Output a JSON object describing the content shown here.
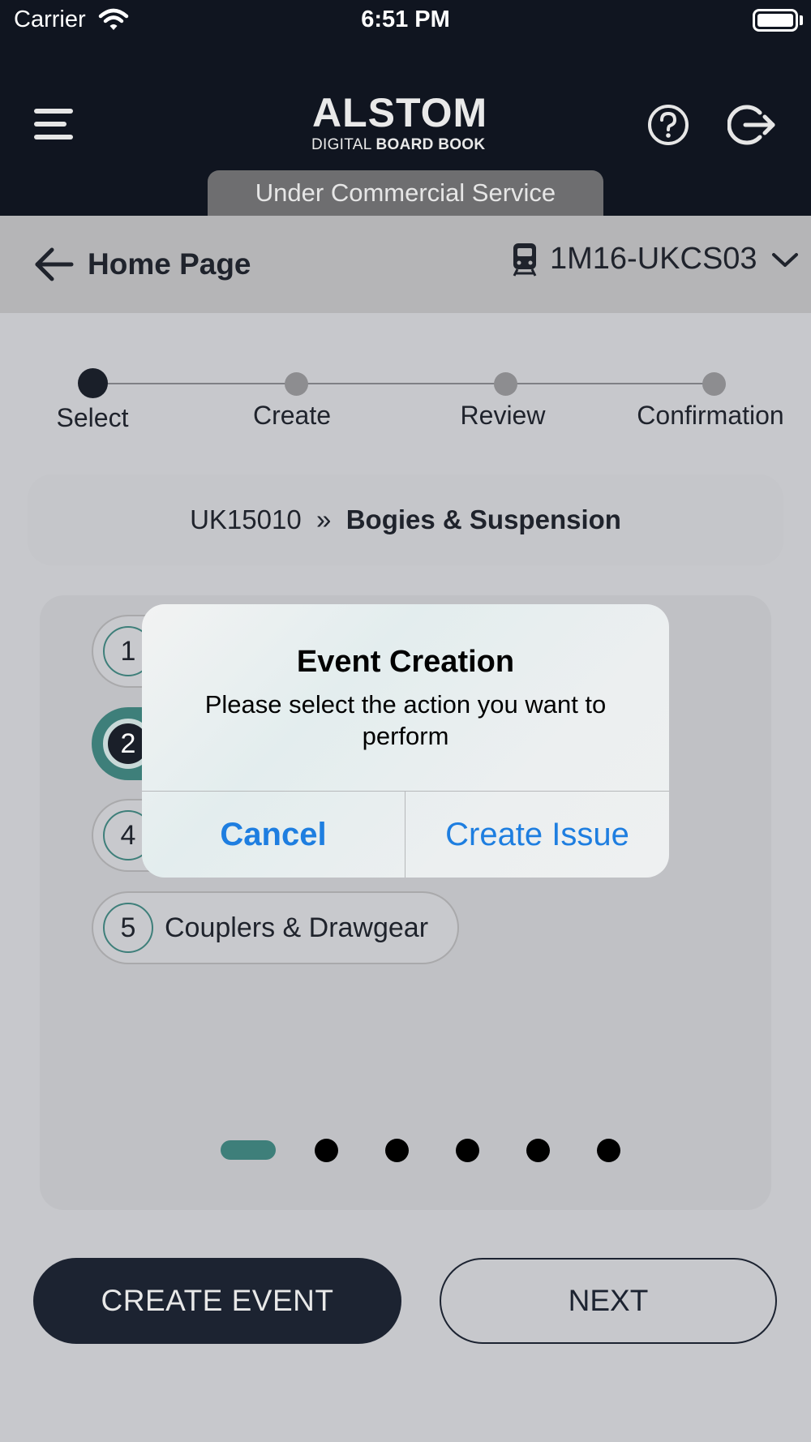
{
  "status_bar": {
    "carrier": "Carrier",
    "time": "6:51 PM"
  },
  "header": {
    "logo_main": "ALSTOM",
    "logo_sub_light": "DIGITAL ",
    "logo_sub_bold": "BOARD BOOK",
    "service_status": "Under Commercial Service"
  },
  "subheader": {
    "title": "Home Page",
    "vehicle": "1M16-UKCS03"
  },
  "stepper": {
    "steps": [
      {
        "label": "Select",
        "active": true
      },
      {
        "label": "Create",
        "active": false
      },
      {
        "label": "Review",
        "active": false
      },
      {
        "label": "Confirmation",
        "active": false
      }
    ]
  },
  "path": {
    "code": "UK15010",
    "separator": "»",
    "category": "Bogies & Suspension"
  },
  "items": [
    {
      "number": "1",
      "label": "",
      "selected": false
    },
    {
      "number": "2",
      "label": "",
      "selected": true
    },
    {
      "number": "4",
      "label": "",
      "selected": false
    },
    {
      "number": "5",
      "label": "Couplers & Drawgear",
      "selected": false
    }
  ],
  "pager": {
    "total": 6,
    "current": 1
  },
  "buttons": {
    "create_event": "CREATE EVENT",
    "next": "NEXT"
  },
  "dialog": {
    "title": "Event Creation",
    "message": "Please select the action you want to perform",
    "cancel": "Cancel",
    "create_issue": "Create Issue"
  },
  "colors": {
    "header_bg": "#101520",
    "accent": "#3e7f7a",
    "dialog_button": "#1e7ee0",
    "primary_button": "#1c2331"
  }
}
